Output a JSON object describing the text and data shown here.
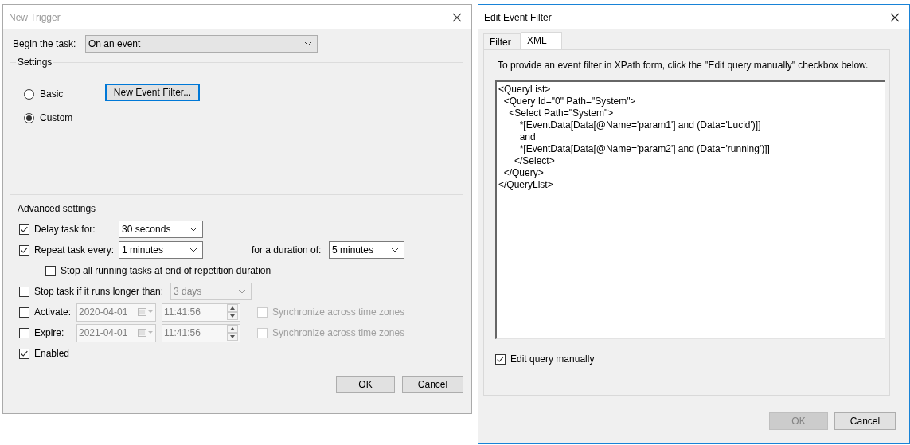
{
  "new_trigger": {
    "title": "New Trigger",
    "active": false,
    "begin": {
      "label": "Begin the task:",
      "value": "On an event"
    },
    "settings": {
      "title": "Settings",
      "radios": [
        {
          "label": "Basic",
          "selected": false
        },
        {
          "label": "Custom",
          "selected": true
        }
      ],
      "filter_button": {
        "label": "New Event Filter...",
        "focused": true
      }
    },
    "advanced": {
      "title": "Advanced settings",
      "delay": {
        "label": "Delay task for:",
        "checked": true,
        "value": "30 seconds"
      },
      "repeat": {
        "label": "Repeat task every:",
        "checked": true,
        "value": "1 minutes",
        "duration_label": "for a duration of:",
        "duration_value": "5 minutes"
      },
      "stop_all": {
        "label": "Stop all running tasks at end of repetition duration",
        "checked": false
      },
      "stop_longer": {
        "label": "Stop task if it runs longer than:",
        "checked": false,
        "value": "3 days"
      },
      "activate": {
        "label": "Activate:",
        "checked": false,
        "date": "2020-04-01",
        "time": "11:41:56",
        "sync_label": "Synchronize across time zones",
        "sync_checked": false
      },
      "expire": {
        "label": "Expire:",
        "checked": false,
        "date": "2021-04-01",
        "time": "11:41:56",
        "sync_label": "Synchronize across time zones",
        "sync_checked": false
      },
      "enabled": {
        "label": "Enabled",
        "checked": true
      }
    },
    "buttons": [
      {
        "label": "OK",
        "disabled": false
      },
      {
        "label": "Cancel",
        "disabled": false
      }
    ]
  },
  "edit_filter": {
    "title": "Edit Event Filter",
    "active": true,
    "tabs": [
      {
        "label": "Filter",
        "selected": false
      },
      {
        "label": "XML",
        "selected": true
      }
    ],
    "hint": "To provide an event filter in XPath form, click the \"Edit query manually\" checkbox below.",
    "xml_lines": [
      "<QueryList>",
      "  <Query Id=\"0\" Path=\"System\">",
      "    <Select Path=\"System\">",
      "        *[EventData[Data[@Name='param1'] and (Data='Lucid')]]",
      "        and",
      "        *[EventData[Data[@Name='param2'] and (Data='running')]]",
      "      </Select>",
      "  </Query>",
      "</QueryList>"
    ],
    "edit_manually": {
      "label": "Edit query manually",
      "checked": true
    },
    "buttons": [
      {
        "label": "OK",
        "disabled": true
      },
      {
        "label": "Cancel",
        "disabled": false
      }
    ]
  }
}
